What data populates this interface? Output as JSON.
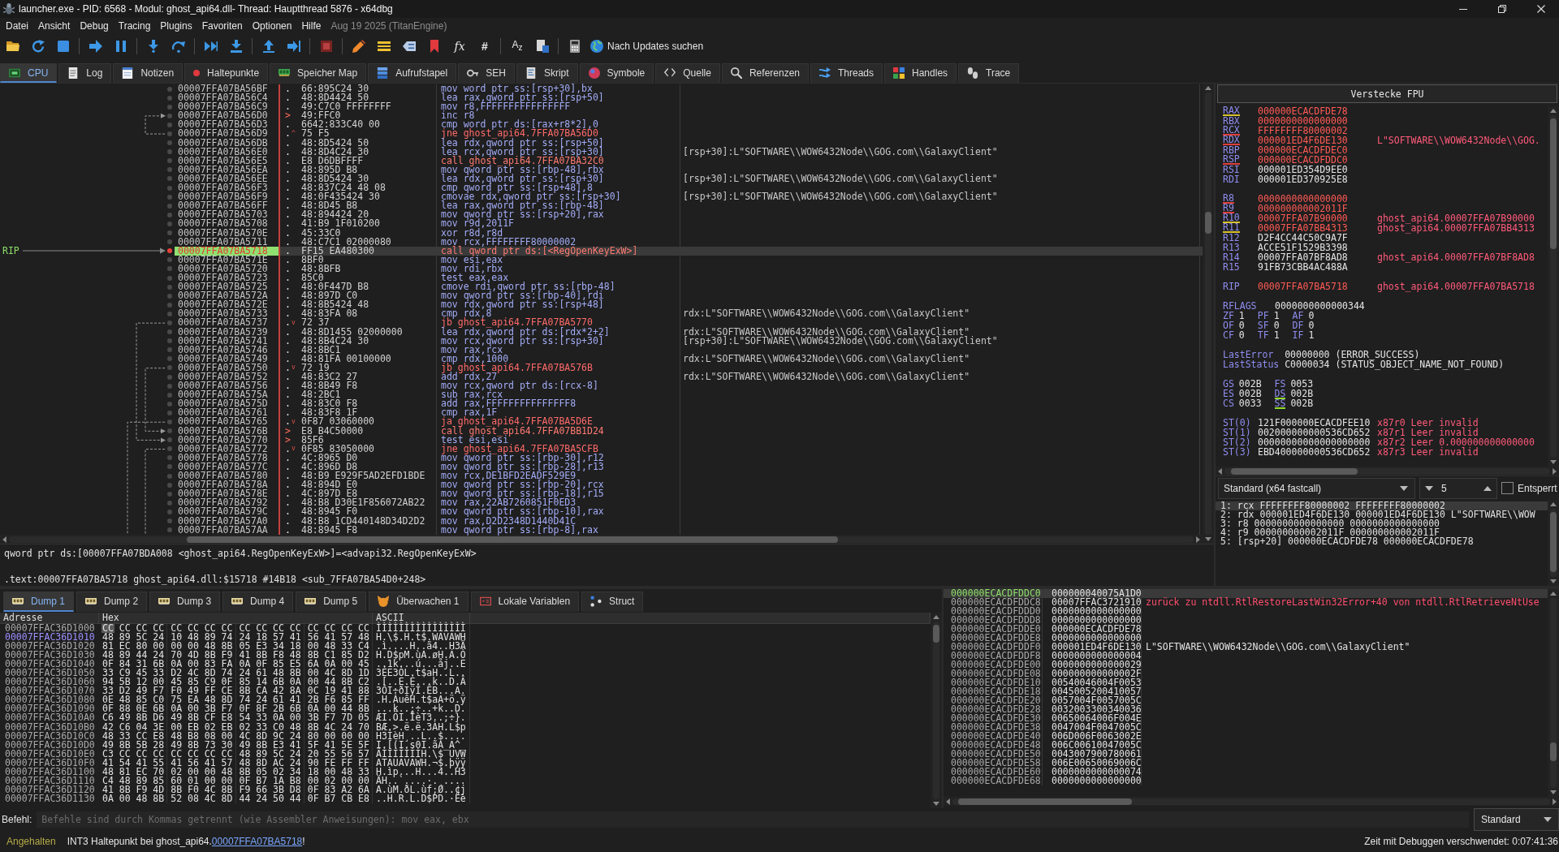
{
  "window": {
    "title": "launcher.exe - PID: 6568 - Modul: ghost_api64.dll- Thread: Hauptthread 5876 - x64dbg"
  },
  "menu": [
    "Datei",
    "Ansicht",
    "Debug",
    "Tracing",
    "Plugins",
    "Favoriten",
    "Optionen",
    "Hilfe"
  ],
  "build_info": "Aug 19 2025 (TitanEngine)",
  "toolbar": {
    "glyphs": [
      "fx",
      "#",
      "A$_{z}$"
    ],
    "update": "Nach Updates suchen"
  },
  "tabs": [
    {
      "label": "CPU",
      "selected": true
    },
    {
      "label": "Log",
      "selected": false
    },
    {
      "label": "Notizen",
      "selected": false
    },
    {
      "label": "Haltepunkte",
      "selected": false
    },
    {
      "label": "Speicher Map",
      "selected": false
    },
    {
      "label": "Aufrufstapel",
      "selected": false
    },
    {
      "label": "SEH",
      "selected": false
    },
    {
      "label": "Skript",
      "selected": false
    },
    {
      "label": "Symbole",
      "selected": false
    },
    {
      "label": "Quelle",
      "selected": false
    },
    {
      "label": "Referenzen",
      "selected": false
    },
    {
      "label": "Threads",
      "selected": false
    },
    {
      "label": "Handles",
      "selected": false
    },
    {
      "label": "Trace",
      "selected": false
    }
  ],
  "disassembly": {
    "rip_label": "RIP",
    "rows": [
      {
        "address": "00007FFA07BA56BF",
        "mark": ".",
        "target": false,
        "bytes": "66:895C24 30",
        "instruction": "mov word ptr ss:[rsp+30],bx",
        "kind": "plain",
        "breakpoint": false,
        "current": false
      },
      {
        "address": "00007FFA07BA56C4",
        "mark": ".",
        "target": false,
        "bytes": "48:8D4424 50",
        "instruction": "lea rax,qword ptr ss:[rsp+50]",
        "kind": "plain",
        "breakpoint": false,
        "current": false
      },
      {
        "address": "00007FFA07BA56C9",
        "mark": ".",
        "target": false,
        "bytes": "49:C7C0 FFFFFFFF",
        "instruction": "mov r8,FFFFFFFFFFFFFFFF",
        "kind": "plain",
        "breakpoint": false,
        "current": false
      },
      {
        "address": "00007FFA07BA56D0",
        "mark": ">",
        "target": true,
        "bytes": "49:FFC0",
        "instruction": "inc r8",
        "kind": "plain",
        "breakpoint": false,
        "current": false
      },
      {
        "address": "00007FFA07BA56D3",
        "mark": ".",
        "target": false,
        "bytes": "6642:833C40 00",
        "instruction": "cmp word ptr ds:[rax+r8*2],0",
        "kind": "plain",
        "breakpoint": false,
        "current": false
      },
      {
        "address": "00007FFA07BA56D9",
        "mark": ".",
        "target": false,
        "jump": "^",
        "bytes": "75 F5",
        "instruction": "jne ghost_api64.7FFA07BA56D0",
        "kind": "jump",
        "breakpoint": false,
        "current": false
      },
      {
        "address": "00007FFA07BA56DB",
        "mark": ".",
        "target": false,
        "bytes": "48:8D5424 50",
        "instruction": "lea rdx,qword ptr ss:[rsp+50]",
        "kind": "plain",
        "breakpoint": false,
        "current": false
      },
      {
        "address": "00007FFA07BA56E0",
        "mark": ".",
        "target": false,
        "bytes": "48:8D4C24 30",
        "instruction": "lea rcx,qword ptr ss:[rsp+30]",
        "kind": "plain",
        "comment": "[rsp+30]:L\"SOFTWARE\\\\WOW6432Node\\\\GOG.com\\\\GalaxyClient\"",
        "breakpoint": false,
        "current": false
      },
      {
        "address": "00007FFA07BA56E5",
        "mark": ".",
        "target": false,
        "bytes": "E8 D6DBFFFF",
        "instruction": "call ghost_api64.7FFA07BA32C0",
        "kind": "call",
        "breakpoint": false,
        "current": false
      },
      {
        "address": "00007FFA07BA56EA",
        "mark": ".",
        "target": false,
        "bytes": "48:895D B8",
        "instruction": "mov qword ptr ss:[rbp-48],rbx",
        "kind": "plain",
        "breakpoint": false,
        "current": false
      },
      {
        "address": "00007FFA07BA56EE",
        "mark": ".",
        "target": false,
        "bytes": "48:8D5424 30",
        "instruction": "lea rdx,qword ptr ss:[rsp+30]",
        "kind": "plain",
        "comment": "[rsp+30]:L\"SOFTWARE\\\\WOW6432Node\\\\GOG.com\\\\GalaxyClient\"",
        "breakpoint": false,
        "current": false
      },
      {
        "address": "00007FFA07BA56F3",
        "mark": ".",
        "target": false,
        "bytes": "48:837C24 48 08",
        "instruction": "cmp qword ptr ss:[rsp+48],8",
        "kind": "plain",
        "breakpoint": false,
        "current": false
      },
      {
        "address": "00007FFA07BA56F9",
        "mark": ".",
        "target": false,
        "bytes": "48:0F435424 30",
        "instruction": "cmovae rdx,qword ptr ss:[rsp+30]",
        "kind": "plain",
        "comment": "[rsp+30]:L\"SOFTWARE\\\\WOW6432Node\\\\GOG.com\\\\GalaxyClient\"",
        "breakpoint": false,
        "current": false
      },
      {
        "address": "00007FFA07BA56FF",
        "mark": ".",
        "target": false,
        "bytes": "48:8D45 B8",
        "instruction": "lea rax,qword ptr ss:[rbp-48]",
        "kind": "plain",
        "breakpoint": false,
        "current": false
      },
      {
        "address": "00007FFA07BA5703",
        "mark": ".",
        "target": false,
        "bytes": "48:894424 20",
        "instruction": "mov qword ptr ss:[rsp+20],rax",
        "kind": "plain",
        "breakpoint": false,
        "current": false
      },
      {
        "address": "00007FFA07BA5708",
        "mark": ".",
        "target": false,
        "bytes": "41:B9 1F010200",
        "instruction": "mov r9d,2011F",
        "kind": "plain",
        "breakpoint": false,
        "current": false
      },
      {
        "address": "00007FFA07BA570E",
        "mark": ".",
        "target": false,
        "bytes": "45:33C0",
        "instruction": "xor r8d,r8d",
        "kind": "plain",
        "breakpoint": false,
        "current": false
      },
      {
        "address": "00007FFA07BA5711",
        "mark": ".",
        "target": false,
        "bytes": "48:C7C1 02000080",
        "instruction": "mov rcx,FFFFFFFF80000002",
        "kind": "plain",
        "breakpoint": false,
        "current": false
      },
      {
        "address": "00007FFA07BA5718",
        "mark": ".",
        "target": false,
        "bytes": "FF15 EA480300",
        "instruction": "call qword ptr ds:[<RegOpenKeyExW>]",
        "kind": "call",
        "breakpoint": true,
        "current": true
      },
      {
        "address": "00007FFA07BA571E",
        "mark": ".",
        "target": false,
        "bytes": "8BF0",
        "instruction": "mov esi,eax",
        "kind": "plain",
        "breakpoint": false,
        "current": false
      },
      {
        "address": "00007FFA07BA5720",
        "mark": ".",
        "target": false,
        "bytes": "48:8BFB",
        "instruction": "mov rdi,rbx",
        "kind": "plain",
        "breakpoint": false,
        "current": false
      },
      {
        "address": "00007FFA07BA5723",
        "mark": ".",
        "target": false,
        "bytes": "85C0",
        "instruction": "test eax,eax",
        "kind": "plain",
        "breakpoint": false,
        "current": false
      },
      {
        "address": "00007FFA07BA5725",
        "mark": ".",
        "target": false,
        "bytes": "48:0F447D B8",
        "instruction": "cmove rdi,qword ptr ss:[rbp-48]",
        "kind": "plain",
        "breakpoint": false,
        "current": false
      },
      {
        "address": "00007FFA07BA572A",
        "mark": ".",
        "target": false,
        "bytes": "48:897D C0",
        "instruction": "mov qword ptr ss:[rbp-40],rdi",
        "kind": "plain",
        "breakpoint": false,
        "current": false
      },
      {
        "address": "00007FFA07BA572E",
        "mark": ".",
        "target": false,
        "bytes": "48:8B5424 48",
        "instruction": "mov rdx,qword ptr ss:[rsp+48]",
        "kind": "plain",
        "breakpoint": false,
        "current": false
      },
      {
        "address": "00007FFA07BA5733",
        "mark": ".",
        "target": false,
        "bytes": "48:83FA 08",
        "instruction": "cmp rdx,8",
        "kind": "plain",
        "comment": "rdx:L\"SOFTWARE\\\\WOW6432Node\\\\GOG.com\\\\GalaxyClient\"",
        "breakpoint": false,
        "current": false
      },
      {
        "address": "00007FFA07BA5737",
        "mark": ".",
        "target": false,
        "jump": "v",
        "bytes": "72 37",
        "instruction": "jb ghost_api64.7FFA07BA5770",
        "kind": "jump",
        "breakpoint": false,
        "current": false
      },
      {
        "address": "00007FFA07BA5739",
        "mark": ".",
        "target": false,
        "bytes": "48:8D1455 02000000",
        "instruction": "lea rdx,qword ptr ds:[rdx*2+2]",
        "kind": "plain",
        "comment": "rdx:L\"SOFTWARE\\\\WOW6432Node\\\\GOG.com\\\\GalaxyClient\"",
        "breakpoint": false,
        "current": false
      },
      {
        "address": "00007FFA07BA5741",
        "mark": ".",
        "target": false,
        "bytes": "48:8B4C24 30",
        "instruction": "mov rcx,qword ptr ss:[rsp+30]",
        "kind": "plain",
        "comment": "[rsp+30]:L\"SOFTWARE\\\\WOW6432Node\\\\GOG.com\\\\GalaxyClient\"",
        "breakpoint": false,
        "current": false
      },
      {
        "address": "00007FFA07BA5746",
        "mark": ".",
        "target": false,
        "bytes": "48:8BC1",
        "instruction": "mov rax,rcx",
        "kind": "plain",
        "breakpoint": false,
        "current": false
      },
      {
        "address": "00007FFA07BA5749",
        "mark": ".",
        "target": false,
        "bytes": "48:81FA 00100000",
        "instruction": "cmp rdx,1000",
        "kind": "plain",
        "comment": "rdx:L\"SOFTWARE\\\\WOW6432Node\\\\GOG.com\\\\GalaxyClient\"",
        "breakpoint": false,
        "current": false
      },
      {
        "address": "00007FFA07BA5750",
        "mark": ".",
        "target": false,
        "jump": "v",
        "bytes": "72 19",
        "instruction": "jb ghost_api64.7FFA07BA576B",
        "kind": "jump",
        "breakpoint": false,
        "current": false
      },
      {
        "address": "00007FFA07BA5752",
        "mark": ".",
        "target": false,
        "bytes": "48:83C2 27",
        "instruction": "add rdx,27",
        "kind": "plain",
        "comment": "rdx:L\"SOFTWARE\\\\WOW6432Node\\\\GOG.com\\\\GalaxyClient\"",
        "breakpoint": false,
        "current": false
      },
      {
        "address": "00007FFA07BA5756",
        "mark": ".",
        "target": false,
        "bytes": "48:8B49 F8",
        "instruction": "mov rcx,qword ptr ds:[rcx-8]",
        "kind": "plain",
        "breakpoint": false,
        "current": false
      },
      {
        "address": "00007FFA07BA575A",
        "mark": ".",
        "target": false,
        "bytes": "48:2BC1",
        "instruction": "sub rax,rcx",
        "kind": "plain",
        "breakpoint": false,
        "current": false
      },
      {
        "address": "00007FFA07BA575D",
        "mark": ".",
        "target": false,
        "bytes": "48:83C0 F8",
        "instruction": "add rax,FFFFFFFFFFFFFFF8",
        "kind": "plain",
        "breakpoint": false,
        "current": false
      },
      {
        "address": "00007FFA07BA5761",
        "mark": ".",
        "target": false,
        "bytes": "48:83F8 1F",
        "instruction": "cmp rax,1F",
        "kind": "plain",
        "breakpoint": false,
        "current": false
      },
      {
        "address": "00007FFA07BA5765",
        "mark": ".",
        "target": false,
        "jump": "v",
        "bytes": "0F87 03060000",
        "instruction": "ja ghost_api64.7FFA07BA5D6E",
        "kind": "jump",
        "breakpoint": false,
        "current": false
      },
      {
        "address": "00007FFA07BA576B",
        "mark": ">",
        "target": true,
        "bytes": "E8 B4C50000",
        "instruction": "call ghost_api64.7FFA07BB1D24",
        "kind": "call",
        "breakpoint": false,
        "current": false
      },
      {
        "address": "00007FFA07BA5770",
        "mark": ">",
        "target": true,
        "bytes": "85F6",
        "instruction": "test esi,esi",
        "kind": "plain",
        "breakpoint": false,
        "current": false
      },
      {
        "address": "00007FFA07BA5772",
        "mark": ".",
        "target": false,
        "jump": "v",
        "bytes": "0F85 83050000",
        "instruction": "jne ghost_api64.7FFA07BA5CFB",
        "kind": "jump",
        "breakpoint": false,
        "current": false
      },
      {
        "address": "00007FFA07BA5778",
        "mark": ".",
        "target": false,
        "bytes": "4C:8965 D0",
        "instruction": "mov qword ptr ss:[rbp-30],r12",
        "kind": "plain",
        "breakpoint": false,
        "current": false
      },
      {
        "address": "00007FFA07BA577C",
        "mark": ".",
        "target": false,
        "bytes": "4C:896D D8",
        "instruction": "mov qword ptr ss:[rbp-28],r13",
        "kind": "plain",
        "breakpoint": false,
        "current": false
      },
      {
        "address": "00007FFA07BA5780",
        "mark": ".",
        "target": false,
        "bytes": "48:B9 E929F5AD2EFD1BDE",
        "instruction": "mov rcx,DE1BFD2EADF529E9",
        "kind": "plain",
        "breakpoint": false,
        "current": false
      },
      {
        "address": "00007FFA07BA578A",
        "mark": ".",
        "target": false,
        "bytes": "48:894D E0",
        "instruction": "mov qword ptr ss:[rbp-20],rcx",
        "kind": "plain",
        "breakpoint": false,
        "current": false
      },
      {
        "address": "00007FFA07BA578E",
        "mark": ".",
        "target": false,
        "bytes": "4C:897D E8",
        "instruction": "mov qword ptr ss:[rbp-18],r15",
        "kind": "plain",
        "breakpoint": false,
        "current": false
      },
      {
        "address": "00007FFA07BA5792",
        "mark": ".",
        "target": false,
        "bytes": "48:B8 D30E1F856072AB22",
        "instruction": "mov rax,22AB7260851F0ED3",
        "kind": "plain",
        "breakpoint": false,
        "current": false
      },
      {
        "address": "00007FFA07BA579C",
        "mark": ".",
        "target": false,
        "bytes": "48:8945 F0",
        "instruction": "mov qword ptr ss:[rbp-10],rax",
        "kind": "plain",
        "breakpoint": false,
        "current": false
      },
      {
        "address": "00007FFA07BA57A0",
        "mark": ".",
        "target": false,
        "bytes": "48:B8 1CD440148D34D2D2",
        "instruction": "mov rax,D2D2348D1440D41C",
        "kind": "plain",
        "breakpoint": false,
        "current": false
      },
      {
        "address": "00007FFA07BA57AA",
        "mark": ".",
        "target": false,
        "bytes": "48:8945 F8",
        "instruction": "mov qword ptr ss:[rbp-8],rax",
        "kind": "plain",
        "breakpoint": false,
        "current": false
      }
    ]
  },
  "info_lines": [
    "qword ptr ds:[00007FFA07BDA008 <ghost_api64.RegOpenKeyExW>]=<advapi32.RegOpenKeyExW>",
    ".text:00007FFA07BA5718 ghost_api64.dll:$15718 #14B18 <sub_7FFA07BA54D0+248>"
  ],
  "registers": {
    "toggle": "Verstecke FPU",
    "groups": [
      {
        "kind": "gpr",
        "rows": [
          {
            "name": "RAX",
            "value": "000000ECACDFDE78",
            "modified": true,
            "color": "#d6c22b"
          },
          {
            "name": "RBX",
            "value": "0000000000000000",
            "modified": true
          },
          {
            "name": "RCX",
            "value": "FFFFFFFF80000002",
            "modified": true,
            "color": "#e0403a"
          },
          {
            "name": "RDX",
            "value": "000001ED4F6DE130",
            "modified": true,
            "color": "#e0403a",
            "comment": "L\"SOFTWARE\\\\WOW6432Node\\\\GOG."
          },
          {
            "name": "RBP",
            "value": "000000ECACDFDEC0",
            "modified": true
          },
          {
            "name": "RSP",
            "value": "000000ECACDFDDC0",
            "modified": true,
            "color": "#e0403a"
          },
          {
            "name": "RSI",
            "value": "000001ED354D9EE0",
            "modified": false
          },
          {
            "name": "RDI",
            "value": "000001ED370925E8",
            "modified": false
          }
        ]
      },
      {
        "kind": "gpr",
        "rows": [
          {
            "name": "R8",
            "value": "0000000000000000",
            "modified": true,
            "color": "#e0403a"
          },
          {
            "name": "R9",
            "value": "000000000002011F",
            "modified": true,
            "color": "#e0403a"
          },
          {
            "name": "R10",
            "value": "00007FFA07B90000",
            "modified": true,
            "color": "#d6c22b",
            "comment": "ghost_api64.00007FFA07B90000"
          },
          {
            "name": "R11",
            "value": "00007FFA07BB4313",
            "modified": true,
            "color": "#d6c22b",
            "comment": "ghost_api64.00007FFA07BB4313"
          },
          {
            "name": "R12",
            "value": "D2F4CC44C50C9A7F",
            "modified": false
          },
          {
            "name": "R13",
            "value": "ACCE51F1529B3398",
            "modified": false
          },
          {
            "name": "R14",
            "value": "00007FFA07BF8AD8",
            "modified": false,
            "comment": "ghost_api64.00007FFA07BF8AD8"
          },
          {
            "name": "R15",
            "value": "91FB73CBB4AC488A",
            "modified": false
          }
        ]
      },
      {
        "kind": "gpr",
        "rows": [
          {
            "name": "RIP",
            "value": "00007FFA07BA5718",
            "modified": true,
            "comment": "ghost_api64.00007FFA07BA5718"
          }
        ]
      },
      {
        "kind": "grid",
        "rows": [
          [
            {
              "name": "RFLAGS",
              "value": "0000000000000344"
            }
          ],
          [
            {
              "name": "ZF",
              "value": "1"
            },
            {
              "name": "PF",
              "value": "1"
            },
            {
              "name": "AF",
              "value": "0"
            }
          ],
          [
            {
              "name": "OF",
              "value": "0"
            },
            {
              "name": "SF",
              "value": "0"
            },
            {
              "name": "DF",
              "value": "0"
            }
          ],
          [
            {
              "name": "CF",
              "value": "0"
            },
            {
              "name": "TF",
              "value": "1"
            },
            {
              "name": "IF",
              "value": "1"
            }
          ]
        ]
      },
      {
        "kind": "grid",
        "rows": [
          [
            {
              "name": "LastError",
              "value": "00000000 (ERROR_SUCCESS)"
            }
          ],
          [
            {
              "name": "LastStatus",
              "value": "C0000034 (STATUS_OBJECT_NAME_NOT_FOUND)"
            }
          ]
        ]
      },
      {
        "kind": "grid",
        "rows": [
          [
            {
              "name": "GS",
              "value": "002B"
            },
            {
              "name": "FS",
              "value": "0053"
            }
          ],
          [
            {
              "name": "ES",
              "value": "002B"
            },
            {
              "name": "DS",
              "value": "002B",
              "color": "#8fdc2a"
            }
          ],
          [
            {
              "name": "CS",
              "value": "0033"
            },
            {
              "name": "SS",
              "value": "002B",
              "color": "#8fdc2a"
            }
          ]
        ]
      },
      {
        "kind": "fpu",
        "rows": [
          {
            "name": "ST(0)",
            "value": "121F000000ECACDFEE10",
            "comment": "x87r0 Leer invalid"
          },
          {
            "name": "ST(1)",
            "value": "002000000000536CD652",
            "comment": "x87r1 Leer invalid"
          },
          {
            "name": "ST(2)",
            "value": "00000000000000000000",
            "comment": "x87r2 Leer 0.000000000000000"
          },
          {
            "name": "ST(3)",
            "value": "EBD400000000536CD652",
            "comment": "x87r3 Leer invalid"
          }
        ]
      }
    ]
  },
  "call_args": {
    "convention": "Standard (x64 fastcall)",
    "count": "5",
    "unlock": {
      "label": "Entsperrt",
      "checked": false
    },
    "rows": [
      {
        "text": "1: rcx FFFFFFFF80000002 FFFFFFFF80000002",
        "selected": true
      },
      {
        "text": "2: rdx 000001ED4F6DE130 000001ED4F6DE130 L\"SOFTWARE\\\\WOW",
        "selected": false
      },
      {
        "text": "3: r8 0000000000000000 0000000000000000",
        "selected": false
      },
      {
        "text": "4: r9 000000000002011F 000000000002011F",
        "selected": false
      },
      {
        "text": "5: [rsp+20] 000000ECACDFDE78 000000ECACDFDE78",
        "selected": false
      }
    ]
  },
  "dump": {
    "tabs": [
      {
        "label": "Dump 1",
        "selected": true
      },
      {
        "label": "Dump 2",
        "selected": false
      },
      {
        "label": "Dump 3",
        "selected": false
      },
      {
        "label": "Dump 4",
        "selected": false
      },
      {
        "label": "Dump 5",
        "selected": false
      },
      {
        "label": "Überwachen 1",
        "selected": false
      },
      {
        "label": "Lokale Variablen",
        "selected": false
      },
      {
        "label": "Struct",
        "selected": false
      }
    ],
    "columns": [
      "Adresse",
      "Hex",
      "ASCII"
    ],
    "rows": [
      {
        "address": "00007FFAC36D1000",
        "hex": [
          "CC CC CC CC",
          "CC CC CC CC",
          "CC CC CC CC",
          "CC CC CC CC"
        ],
        "ascii": "ÌÌÌÌÌÌÌÌÌÌÌÌÌÌÌÌ",
        "highlighted": false,
        "selected": true
      },
      {
        "address": "00007FFAC36D1010",
        "hex": [
          "48 89 5C 24",
          "10 48 89 74",
          "24 18 57 41",
          "56 41 57 48"
        ],
        "ascii": "H.\\$.H.t$.WAVAWH",
        "highlighted": true,
        "selected": false
      },
      {
        "address": "00007FFAC36D1020",
        "hex": [
          "81 EC 80 00",
          "00 00 48 8B",
          "05 E3 34 18",
          "00 48 33 C4"
        ],
        "ascii": ".ì....H..ã4..H3Ä",
        "highlighted": false,
        "selected": false
      },
      {
        "address": "00007FFAC36D1030",
        "hex": [
          "48 89 44 24",
          "70 4D 8B F9",
          "41 8B F8 48",
          "8B C1 85 D2"
        ],
        "ascii": "H.D$pM.ùA.øH.Á.Ò",
        "highlighted": false,
        "selected": false
      },
      {
        "address": "00007FFAC36D1040",
        "hex": [
          "0F 84 31 6B",
          "0A 00 83 FA",
          "0A 0F 85 E5",
          "6A 0A 00 45"
        ],
        "ascii": "..1k...ú...åj..E",
        "highlighted": false,
        "selected": false
      },
      {
        "address": "00007FFAC36D1050",
        "hex": [
          "33 C9 45 33",
          "D2 4C 8D 74",
          "24 61 48 8B",
          "00 4C 8D 1D"
        ],
        "ascii": "3ÉE3ÒL.t$aH..L..",
        "highlighted": false,
        "selected": false
      },
      {
        "address": "00007FFAC36D1060",
        "hex": [
          "94 5B 12 00",
          "45 85 C9 0F",
          "85 14 6B 0A",
          "00 44 8B C2"
        ],
        "ascii": ".[..E.É...k..D.Â",
        "highlighted": false,
        "selected": false
      },
      {
        "address": "00007FFAC36D1070",
        "hex": [
          "33 D2 49 F7",
          "F0 49 FF CE",
          "8B CA 42 8A",
          "0C 19 41 88"
        ],
        "ascii": "3ÒI÷ðIÿÎ.ÊB...A.",
        "highlighted": false,
        "selected": false
      },
      {
        "address": "00007FFAC36D1080",
        "hex": [
          "0E 48 85 C0",
          "75 EA 48 8D",
          "74 24 61 41",
          "2B F6 85 FF"
        ],
        "ascii": ".H.ÀuêH.t$aA+ö.ÿ",
        "highlighted": false,
        "selected": false
      },
      {
        "address": "00007FFAC36D1090",
        "hex": [
          "0F 88 0E 6B",
          "0A 00 3B F7",
          "0F 8F 2B 6B",
          "0A 00 44 8B"
        ],
        "ascii": "...k..;÷..+k..D.",
        "highlighted": false,
        "selected": false
      },
      {
        "address": "00007FFAC36D10A0",
        "hex": [
          "C6 49 8B D6",
          "49 8B CF E8",
          "54 33 0A 00",
          "3B F7 7D 05"
        ],
        "ascii": "ÆI.ÖI.ÏèT3..;÷}.",
        "highlighted": false,
        "selected": false
      },
      {
        "address": "00007FFAC36D10B0",
        "hex": [
          "42 C6 04 3E",
          "00 EB 02 EB",
          "02 33 C0 48",
          "8B 4C 24 70"
        ],
        "ascii": "BÆ.>.ë.ë.3ÀH.L$p",
        "highlighted": false,
        "selected": false
      },
      {
        "address": "00007FFAC36D10C0",
        "hex": [
          "48 33 CC E8",
          "48 B8 08 00",
          "4C 8D 9C 24",
          "80 00 00 00"
        ],
        "ascii": "H3ÌèH¸..L..$....",
        "highlighted": false,
        "selected": false
      },
      {
        "address": "00007FFAC36D10D0",
        "hex": [
          "49 8B 5B 28",
          "49 8B 73 30",
          "49 8B E3 41",
          "5F 41 5E 5F"
        ],
        "ascii": "I.[(I.s0I.ãA_A^_",
        "highlighted": false,
        "selected": false
      },
      {
        "address": "00007FFAC36D10E0",
        "hex": [
          "C3 CC CC CC",
          "CC CC CC CC",
          "48 89 5C 24",
          "20 55 56 57"
        ],
        "ascii": "ÃÌÌÌÌÌÌÌH.\\$ UVW",
        "highlighted": false,
        "selected": false
      },
      {
        "address": "00007FFAC36D10F0",
        "hex": [
          "41 54 41 55",
          "41 56 41 57",
          "48 8D AC 24",
          "90 FE FF FF"
        ],
        "ascii": "ATAUAVAWH.¬$.þÿÿ",
        "highlighted": false,
        "selected": false
      },
      {
        "address": "00007FFAC36D1100",
        "hex": [
          "48 81 EC 70",
          "02 00 00 48",
          "8B 05 02 34",
          "18 00 48 33"
        ],
        "ascii": "H.ìp...H...4..H3",
        "highlighted": false,
        "selected": false
      },
      {
        "address": "00007FFAC36D1110",
        "hex": [
          "C4 48 89 85",
          "60 01 00 00",
          "0F B7 1A B8",
          "00 02 00 00"
        ],
        "ascii": "ÄH..`....·.¸....",
        "highlighted": false,
        "selected": false
      },
      {
        "address": "00007FFAC36D1120",
        "hex": [
          "41 8B F9 4D",
          "8B F0 4C 8B",
          "F9 66 3B D8",
          "0F 83 A2 6A"
        ],
        "ascii": "A.ùM.ðL.ùf;Ø..¢j",
        "highlighted": false,
        "selected": false
      },
      {
        "address": "00007FFAC36D1130",
        "hex": [
          "0A 00 48 8B",
          "52 08 4C 8D",
          "44 24 50 44",
          "0F B7 CB E8"
        ],
        "ascii": "..H.R.L.D$PD.·Ëè",
        "highlighted": false,
        "selected": false
      }
    ]
  },
  "stack": {
    "rows": [
      {
        "address": "000000ECACDFDDC0",
        "value": "000000040075A1D0",
        "selected": true
      },
      {
        "address": "000000ECACDFDDC8",
        "value": "00007FFAC3721910",
        "comment": {
          "kind": "return",
          "text": "zurück zu ntdll.RtlRestoreLastWin32Error+40 von ntdll.RtlRetrieveNtUse"
        },
        "selected": false
      },
      {
        "address": "000000ECACDFDDD0",
        "value": "0000000000000000",
        "selected": false
      },
      {
        "address": "000000ECACDFDDD8",
        "value": "0000000000000000",
        "selected": false
      },
      {
        "address": "000000ECACDFDDE0",
        "value": "000000ECACDFDE78",
        "selected": false
      },
      {
        "address": "000000ECACDFDDE8",
        "value": "0000000000000000",
        "selected": false
      },
      {
        "address": "000000ECACDFDDF0",
        "value": "000001ED4F6DE130",
        "comment": {
          "kind": "string",
          "text": "L\"SOFTWARE\\\\WOW6432Node\\\\GOG.com\\\\GalaxyClient\""
        },
        "selected": false
      },
      {
        "address": "000000ECACDFDDF8",
        "value": "0000000000000004",
        "selected": false
      },
      {
        "address": "000000ECACDFDE00",
        "value": "0000000000000029",
        "selected": false
      },
      {
        "address": "000000ECACDFDE08",
        "value": "000000000000002F",
        "selected": false
      },
      {
        "address": "000000ECACDFDE10",
        "value": "00540046004F0053",
        "selected": false
      },
      {
        "address": "000000ECACDFDE18",
        "value": "0045005200410057",
        "selected": false
      },
      {
        "address": "000000ECACDFDE20",
        "value": "0057004F0057005C",
        "selected": false
      },
      {
        "address": "000000ECACDFDE28",
        "value": "0032003300340036",
        "selected": false
      },
      {
        "address": "000000ECACDFDE30",
        "value": "00650064006F004E",
        "selected": false
      },
      {
        "address": "000000ECACDFDE38",
        "value": "0047004F0047005C",
        "selected": false
      },
      {
        "address": "000000ECACDFDE40",
        "value": "006D006F0063002E",
        "selected": false
      },
      {
        "address": "000000ECACDFDE48",
        "value": "006C00610047005C",
        "selected": false
      },
      {
        "address": "000000ECACDFDE50",
        "value": "0043007900780061",
        "selected": false
      },
      {
        "address": "000000ECACDFDE58",
        "value": "006E00650069006C",
        "selected": false
      },
      {
        "address": "000000ECACDFDE60",
        "value": "0000000000000074",
        "selected": false
      },
      {
        "address": "000000ECACDFDE68",
        "value": "0000000000000000",
        "selected": false
      }
    ]
  },
  "command": {
    "label": "Befehl:",
    "placeholder": "Befehle sind durch Kommas getrennt (wie Assembler Anweisungen): mov eax, ebx",
    "mode": "Standard"
  },
  "status": {
    "state": "Angehalten",
    "message": "INT3 Haltepunkt bei ghost_api64.",
    "link": "00007FFA07BA5718",
    "end": "!",
    "timer": "Zeit mit Debuggen verschwendet: 0:07:41:36"
  }
}
